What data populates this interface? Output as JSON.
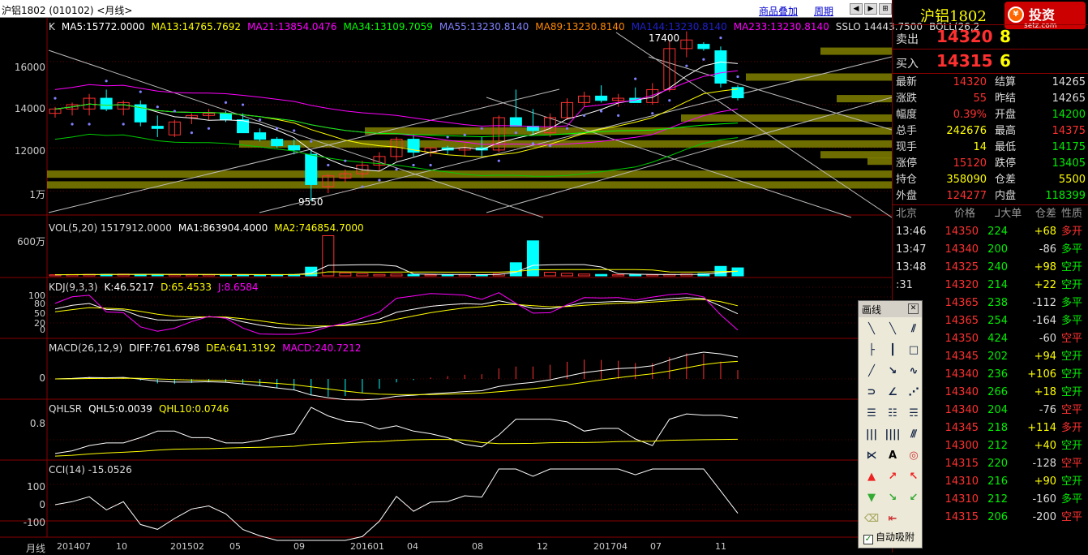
{
  "window_title": "沪铝1802 (010102) <月线>",
  "toolbar": {
    "overlay_label": "商品叠加",
    "period_label": "周期"
  },
  "colors": {
    "up": "#ff3030",
    "down": "#00ffff",
    "ma5": "#ffffff",
    "ma13": "#ffff00",
    "ma21": "#ff00ff",
    "ma34": "#00ff00",
    "ma55": "#8080ff",
    "ma89": "#ff8800",
    "zone": "#808000"
  },
  "main_panel": {
    "legend": {
      "k": "K",
      "ma5": "MA5:15772.0000",
      "ma13": "MA13:14765.7692",
      "ma21": "MA21:13854.0476",
      "ma34": "MA34:13109.7059",
      "ma55": "MA55:13230.8140",
      "ma89": "MA89:13230.8140",
      "ma144": "MA144:13230.8140",
      "ma233": "MA233:13230.8140",
      "sslo": "SSLO  14443.7500",
      "boll": "BOLL(26,2"
    },
    "y_labels": [
      "16000",
      "14000",
      "12000",
      "1万"
    ],
    "high_mark": "17400",
    "low_mark": "9550"
  },
  "vol_panel": {
    "legend": {
      "vol": "VOL(5,20)  1517912.0000",
      "ma1": "MA1:863904.4000",
      "ma2": "MA2:746854.7000"
    },
    "y_label": "600万"
  },
  "kdj_panel": {
    "legend": {
      "kdj": "KDJ(9,3,3)",
      "k": "K:46.5217",
      "d": "D:65.4533",
      "j": "J:8.6584"
    },
    "y_labels": [
      "100",
      "80",
      "50",
      "20",
      "0"
    ]
  },
  "macd_panel": {
    "legend": {
      "macd": "MACD(26,12,9)",
      "diff": "DIFF:761.6798",
      "dea": "DEA:641.3192",
      "macdv": "MACD:240.7212"
    },
    "y_label": "0"
  },
  "qhlsr_panel": {
    "legend": {
      "q": "QHLSR",
      "q5": "QHL5:0.0039",
      "q10": "QHL10:0.0746"
    },
    "y_label": "0.8"
  },
  "cci_panel": {
    "legend": {
      "cci": "CCI(14)  -15.0526"
    },
    "y_labels": [
      "100",
      "0",
      "-100"
    ]
  },
  "x_axis": {
    "period_label": "月线",
    "labels": [
      "201407",
      "10",
      "201502",
      "05",
      "09",
      "201601",
      "04",
      "08",
      "12",
      "201704",
      "07",
      "11"
    ]
  },
  "quote": {
    "title": "沪铝1802",
    "logo_text": "投资",
    "logo_sub": "setz.com",
    "sell": {
      "label": "卖出",
      "price": "14320",
      "vol": "8"
    },
    "buy": {
      "label": "买入",
      "price": "14315",
      "vol": "6"
    },
    "stats": [
      {
        "l1": "最新",
        "v1": "14320",
        "c1": "red",
        "l2": "结算",
        "v2": "14265",
        "c2": "white"
      },
      {
        "l1": "涨跌",
        "v1": "55",
        "c1": "red",
        "l2": "昨结",
        "v2": "14265",
        "c2": "white"
      },
      {
        "l1": "幅度",
        "v1": "0.39%",
        "c1": "red",
        "l2": "开盘",
        "v2": "14200",
        "c2": "green"
      },
      {
        "l1": "总手",
        "v1": "242676",
        "c1": "yellow",
        "l2": "最高",
        "v2": "14375",
        "c2": "red"
      },
      {
        "l1": "现手",
        "v1": "14",
        "c1": "yellow",
        "l2": "最低",
        "v2": "14175",
        "c2": "green"
      },
      {
        "l1": "涨停",
        "v1": "15120",
        "c1": "red",
        "l2": "跌停",
        "v2": "13405",
        "c2": "green"
      },
      {
        "l1": "持仓",
        "v1": "358090",
        "c1": "yellow",
        "l2": "仓差",
        "v2": "5500",
        "c2": "yellow"
      },
      {
        "l1": "外盘",
        "v1": "124277",
        "c1": "red",
        "l2": "内盘",
        "v2": "118399",
        "c2": "green"
      }
    ],
    "tick_header": {
      "time": "北京",
      "price": "价格",
      "vol": "⅃大单",
      "diff": "仓差",
      "nature": "性质"
    },
    "ticks": [
      {
        "time": "13:46",
        "price": "14350",
        "vol": "224",
        "diff": "+68",
        "nature": "多开",
        "nc": "red"
      },
      {
        "time": "13:47",
        "price": "14340",
        "vol": "200",
        "diff": "-86",
        "nature": "多平",
        "nc": "green"
      },
      {
        "time": "13:48",
        "price": "14325",
        "vol": "240",
        "diff": "+98",
        "nature": "空开",
        "nc": "green"
      },
      {
        "time": ":31",
        "price": "14320",
        "vol": "214",
        "diff": "+22",
        "nature": "空开",
        "nc": "green"
      },
      {
        "time": "",
        "price": "14365",
        "vol": "238",
        "diff": "-112",
        "nature": "多平",
        "nc": "green"
      },
      {
        "time": "",
        "price": "14365",
        "vol": "254",
        "diff": "-164",
        "nature": "多平",
        "nc": "green"
      },
      {
        "time": "",
        "price": "14350",
        "vol": "424",
        "diff": "-60",
        "nature": "空平",
        "nc": "red"
      },
      {
        "time": "",
        "price": "14345",
        "vol": "202",
        "diff": "+94",
        "nature": "空开",
        "nc": "green"
      },
      {
        "time": "",
        "price": "14340",
        "vol": "236",
        "diff": "+106",
        "nature": "空开",
        "nc": "green"
      },
      {
        "time": "",
        "price": "14340",
        "vol": "266",
        "diff": "+18",
        "nature": "空开",
        "nc": "green"
      },
      {
        "time": "",
        "price": "14340",
        "vol": "204",
        "diff": "-76",
        "nature": "空平",
        "nc": "red"
      },
      {
        "time": "",
        "price": "14345",
        "vol": "218",
        "diff": "+114",
        "nature": "多开",
        "nc": "red"
      },
      {
        "time": "",
        "price": "14300",
        "vol": "212",
        "diff": "+40",
        "nature": "空开",
        "nc": "green"
      },
      {
        "time": "",
        "price": "14315",
        "vol": "220",
        "diff": "-128",
        "nature": "空平",
        "nc": "red"
      },
      {
        "time": "",
        "price": "14310",
        "vol": "216",
        "diff": "+90",
        "nature": "空开",
        "nc": "green"
      },
      {
        "time": "",
        "price": "14310",
        "vol": "212",
        "diff": "-160",
        "nature": "多平",
        "nc": "green"
      },
      {
        "time": "",
        "price": "14315",
        "vol": "206",
        "diff": "-200",
        "nature": "空平",
        "nc": "red"
      }
    ]
  },
  "palette": {
    "title": "画线",
    "auto_label": "自动吸附",
    "text_tool": "A"
  },
  "chart_data": {
    "type": "candlestick",
    "title": "沪铝1802 (010102) 月线",
    "price_ylim": [
      9000,
      17800
    ],
    "candles": [
      {
        "o": 13600,
        "h": 13900,
        "l": 13400,
        "c": 13800
      },
      {
        "o": 13800,
        "h": 14100,
        "l": 13500,
        "c": 14000
      },
      {
        "o": 13800,
        "h": 14500,
        "l": 13500,
        "c": 14300
      },
      {
        "o": 14300,
        "h": 14700,
        "l": 13700,
        "c": 13800
      },
      {
        "o": 13800,
        "h": 14200,
        "l": 13500,
        "c": 14100
      },
      {
        "o": 14000,
        "h": 14200,
        "l": 13000,
        "c": 13200
      },
      {
        "o": 13000,
        "h": 13500,
        "l": 12500,
        "c": 12900
      },
      {
        "o": 12600,
        "h": 13300,
        "l": 12500,
        "c": 13200
      },
      {
        "o": 13400,
        "h": 13600,
        "l": 13100,
        "c": 13500
      },
      {
        "o": 13500,
        "h": 13800,
        "l": 13300,
        "c": 13600
      },
      {
        "o": 13600,
        "h": 13700,
        "l": 13200,
        "c": 13300
      },
      {
        "o": 13300,
        "h": 13600,
        "l": 12700,
        "c": 12700
      },
      {
        "o": 12700,
        "h": 12900,
        "l": 12300,
        "c": 12400
      },
      {
        "o": 12400,
        "h": 12500,
        "l": 12000,
        "c": 12100
      },
      {
        "o": 12100,
        "h": 12400,
        "l": 11700,
        "c": 11900
      },
      {
        "o": 11700,
        "h": 11900,
        "l": 9550,
        "c": 10300
      },
      {
        "o": 10200,
        "h": 10800,
        "l": 9900,
        "c": 10700
      },
      {
        "o": 10600,
        "h": 11000,
        "l": 10400,
        "c": 10800
      },
      {
        "o": 10800,
        "h": 11400,
        "l": 10600,
        "c": 11200
      },
      {
        "o": 11200,
        "h": 11800,
        "l": 10900,
        "c": 11600
      },
      {
        "o": 11600,
        "h": 12500,
        "l": 11400,
        "c": 12400
      },
      {
        "o": 12400,
        "h": 12600,
        "l": 11600,
        "c": 11800
      },
      {
        "o": 11800,
        "h": 12000,
        "l": 11600,
        "c": 12000
      },
      {
        "o": 12000,
        "h": 12100,
        "l": 11700,
        "c": 11900
      },
      {
        "o": 11900,
        "h": 12200,
        "l": 11600,
        "c": 12000
      },
      {
        "o": 12000,
        "h": 12500,
        "l": 11600,
        "c": 11900
      },
      {
        "o": 11900,
        "h": 13500,
        "l": 11800,
        "c": 13400
      },
      {
        "o": 13400,
        "h": 14700,
        "l": 13100,
        "c": 13000
      },
      {
        "o": 13000,
        "h": 13800,
        "l": 12600,
        "c": 12800
      },
      {
        "o": 12700,
        "h": 13600,
        "l": 12500,
        "c": 13400
      },
      {
        "o": 13400,
        "h": 14300,
        "l": 13300,
        "c": 14100
      },
      {
        "o": 14100,
        "h": 14600,
        "l": 13900,
        "c": 14400
      },
      {
        "o": 14400,
        "h": 14900,
        "l": 14100,
        "c": 14200
      },
      {
        "o": 14200,
        "h": 14500,
        "l": 13900,
        "c": 14300
      },
      {
        "o": 14300,
        "h": 14800,
        "l": 14100,
        "c": 14100
      },
      {
        "o": 14100,
        "h": 15000,
        "l": 14000,
        "c": 14700
      },
      {
        "o": 14700,
        "h": 17000,
        "l": 14600,
        "c": 16600
      },
      {
        "o": 16600,
        "h": 17400,
        "l": 16200,
        "c": 17000
      },
      {
        "o": 16800,
        "h": 16900,
        "l": 16500,
        "c": 16600
      },
      {
        "o": 16500,
        "h": 16700,
        "l": 14800,
        "c": 15000
      },
      {
        "o": 14800,
        "h": 14900,
        "l": 14200,
        "c": 14320
      }
    ],
    "volume_ylim": [
      0,
      7000000
    ],
    "volume": [
      150000,
      180000,
      200000,
      220000,
      240000,
      200000,
      180000,
      170000,
      160000,
      180000,
      170000,
      160000,
      150000,
      170000,
      190000,
      1200000,
      5500000,
      400000,
      300000,
      200000,
      250000,
      200000,
      150000,
      160000,
      170000,
      150000,
      300000,
      1800000,
      4800000,
      500000,
      350000,
      250000,
      200000,
      180000,
      170000,
      160000,
      200000,
      250000,
      300000,
      1300000,
      1100000
    ]
  }
}
